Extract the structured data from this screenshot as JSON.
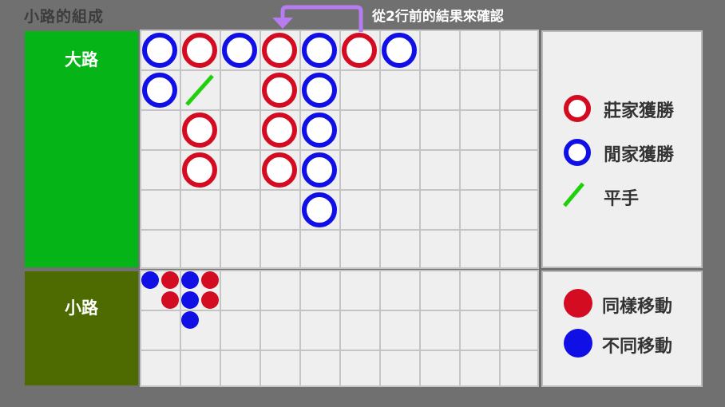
{
  "header": {
    "title": "小路的組成",
    "note": "從2行前的結果來確認"
  },
  "sections": {
    "big_road_label": "大路",
    "small_road_label": "小路"
  },
  "colors": {
    "banker": "#d40c22",
    "player": "#0f0fe6",
    "tie": "#1ed10b",
    "arrow": "#b57df0",
    "big_road_bg": "#05b518",
    "small_road_bg": "#4d6b00"
  },
  "legend_results": [
    {
      "icon": "red-ring-icon",
      "label": "莊家獲勝"
    },
    {
      "icon": "blue-ring-icon",
      "label": "閒家獲勝"
    },
    {
      "icon": "green-slash-icon",
      "label": "平手"
    }
  ],
  "legend_movement": [
    {
      "icon": "red-dot-icon",
      "label": "同樣移動"
    },
    {
      "icon": "blue-dot-icon",
      "label": "不同移動"
    }
  ],
  "big_road": [
    {
      "col": 0,
      "row": 0,
      "type": "P"
    },
    {
      "col": 0,
      "row": 1,
      "type": "P"
    },
    {
      "col": 1,
      "row": 0,
      "type": "B"
    },
    {
      "col": 1,
      "row": 1,
      "type": "T"
    },
    {
      "col": 1,
      "row": 2,
      "type": "B"
    },
    {
      "col": 1,
      "row": 3,
      "type": "B"
    },
    {
      "col": 2,
      "row": 0,
      "type": "P"
    },
    {
      "col": 3,
      "row": 0,
      "type": "B"
    },
    {
      "col": 3,
      "row": 1,
      "type": "B"
    },
    {
      "col": 3,
      "row": 2,
      "type": "B"
    },
    {
      "col": 3,
      "row": 3,
      "type": "B"
    },
    {
      "col": 4,
      "row": 0,
      "type": "P"
    },
    {
      "col": 4,
      "row": 1,
      "type": "P"
    },
    {
      "col": 4,
      "row": 2,
      "type": "P"
    },
    {
      "col": 4,
      "row": 3,
      "type": "P"
    },
    {
      "col": 4,
      "row": 4,
      "type": "P"
    },
    {
      "col": 5,
      "row": 0,
      "type": "B"
    },
    {
      "col": 6,
      "row": 0,
      "type": "P"
    }
  ],
  "small_road": [
    {
      "col": 0,
      "row": 0,
      "type": "blue"
    },
    {
      "col": 1,
      "row": 0,
      "type": "red"
    },
    {
      "col": 1,
      "row": 1,
      "type": "red"
    },
    {
      "col": 2,
      "row": 0,
      "type": "blue"
    },
    {
      "col": 2,
      "row": 1,
      "type": "blue"
    },
    {
      "col": 2,
      "row": 2,
      "type": "blue"
    },
    {
      "col": 3,
      "row": 0,
      "type": "red"
    },
    {
      "col": 3,
      "row": 1,
      "type": "red"
    }
  ]
}
